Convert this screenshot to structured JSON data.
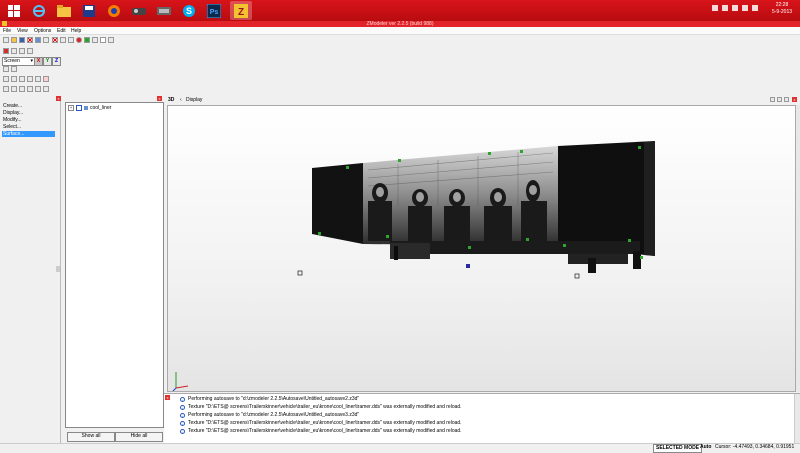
{
  "taskbar": {
    "clock_time": "22:28",
    "clock_date": "5-9-2013",
    "pinned_apps": [
      "windows-start",
      "internet-explorer",
      "file-explorer",
      "save-app",
      "firefox",
      "game-app",
      "game-app-2",
      "skype",
      "photoshop",
      "zmodeler"
    ],
    "accent": "#d8141a"
  },
  "window": {
    "title": "ZModeler ver 2.2.5 (build 988)"
  },
  "menu": {
    "file": "File",
    "view": "View",
    "options": "Options",
    "edit": "Edit",
    "help": "Help"
  },
  "toolbar": {
    "screen_select": "Screen",
    "axis_x": "X",
    "axis_y": "Y",
    "axis_z": "Z"
  },
  "commands": {
    "create": "Create...",
    "display": "Display...",
    "modify": "Modify...",
    "select": "Select...",
    "surface": "Surface..."
  },
  "tree": {
    "root_label": "cool_liner"
  },
  "tree_buttons": {
    "show_all": "Show all",
    "hide_all": "Hide all"
  },
  "viewport": {
    "mode_label": "3D",
    "header_label": "Display"
  },
  "log": {
    "lines": [
      "Performing autosave to \"d:\\zmodeler 2.2.5\\Autosave\\Untitled_autosave2.z3d\"",
      "Texture \"D:\\ETS@ screens\\Trailerskinner\\vehicle\\trailer_eu\\krone\\cool_liner\\tramer.dds\" was externally modified and reload.",
      "Performing autosave to \"d:\\zmodeler 2.2.5\\Autosave\\Untitled_autosave3.z3d\"",
      "Texture \"D:\\ETS@ screens\\Trailerskinner\\vehicle\\trailer_eu\\krone\\cool_liner\\tramer.dds\" was externally modified and reload.",
      "Texture \"D:\\ETS@ screens\\Trailerskinner\\vehicle\\trailer_eu\\krone\\cool_liner\\tramer.dds\" was externally modified and reload."
    ]
  },
  "status": {
    "mode": "SELECTED MODE",
    "auto": "Auto",
    "cursor": "Cursor: -4.47493, 0.34684, 0.91951"
  }
}
